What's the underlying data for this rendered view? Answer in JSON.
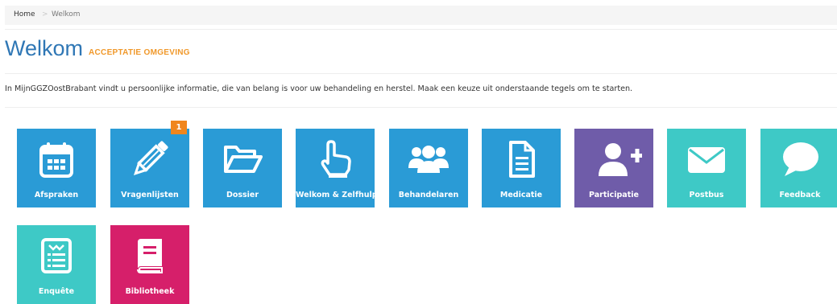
{
  "breadcrumb": {
    "home": "Home",
    "separator": ">",
    "current": "Welkom"
  },
  "header": {
    "title": "Welkom",
    "environment": "ACCEPTATIE OMGEVING"
  },
  "intro": "In MijnGGZOostBrabant vindt u persoonlijke informatie, die van belang is voor uw behandeling en herstel. Maak een keuze uit onderstaande tegels om te starten.",
  "colors": {
    "blue": "#2a9bd6",
    "purple": "#6f5ca9",
    "teal": "#3ec9c6",
    "pink": "#d61f6a",
    "title": "#2f77b5",
    "environment": "#f0982a",
    "badge": "#f0861d"
  },
  "tiles": [
    {
      "label": "Afspraken",
      "icon": "calendar-icon"
    },
    {
      "label": "Vragenlijsten",
      "icon": "pencil-icon",
      "badge": "1"
    },
    {
      "label": "Dossier",
      "icon": "folder-open-icon"
    },
    {
      "label": "Welkom & Zelfhulp",
      "icon": "hand-pointer-icon"
    },
    {
      "label": "Behandelaren",
      "icon": "users-icon"
    },
    {
      "label": "Medicatie",
      "icon": "document-icon"
    },
    {
      "label": "Participatie",
      "icon": "user-plus-icon"
    },
    {
      "label": "Postbus",
      "icon": "envelope-icon"
    },
    {
      "label": "Feedback",
      "icon": "speech-bubble-icon"
    },
    {
      "label": "Enquête",
      "icon": "survey-icon"
    },
    {
      "label": "Bibliotheek",
      "icon": "book-icon"
    }
  ]
}
